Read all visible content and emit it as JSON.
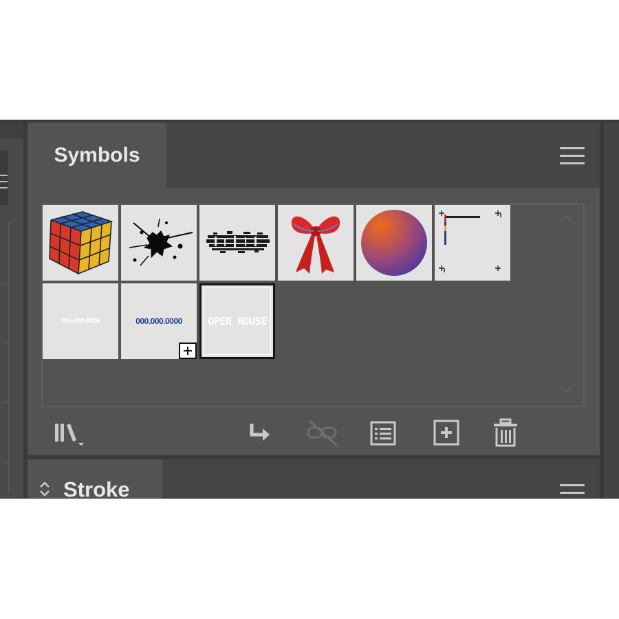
{
  "symbols_panel": {
    "tab_label": "Symbols",
    "menu_icon": "hamburger-menu-icon",
    "thumbnails": [
      {
        "name": "rubiks-cube",
        "icon": "rubiks-cube-icon"
      },
      {
        "name": "ink-splat",
        "icon": "ink-splat-icon"
      },
      {
        "name": "grunge-brush",
        "icon": "grunge-brush-icon"
      },
      {
        "name": "red-bow",
        "icon": "bow-icon"
      },
      {
        "name": "gradient-sphere",
        "icon": "sphere-icon"
      },
      {
        "name": "corner-marks",
        "icon": "corner-marks-icon"
      },
      {
        "name": "white-text-banner",
        "text": "000-000-0000",
        "color": "#ffffff"
      },
      {
        "name": "phone-number",
        "text": "000.000.0000",
        "color": "#1c3f94"
      },
      {
        "name": "open-house",
        "text": "OPEN HOUSE",
        "color": "#ffffff",
        "selected": true
      }
    ],
    "footer_icons": [
      "symbol-libraries-menu-icon",
      "place-symbol-instance-icon",
      "break-link-icon",
      "symbol-options-icon",
      "new-symbol-icon",
      "delete-symbol-icon"
    ]
  },
  "stroke_panel": {
    "tab_label": "Stroke"
  },
  "colors": {
    "panel_bg": "#535353",
    "tabbar_bg": "#454545",
    "app_bg": "#3a3a3a",
    "thumb_bg": "#e3e3e3",
    "text": "#e8e8e8"
  }
}
